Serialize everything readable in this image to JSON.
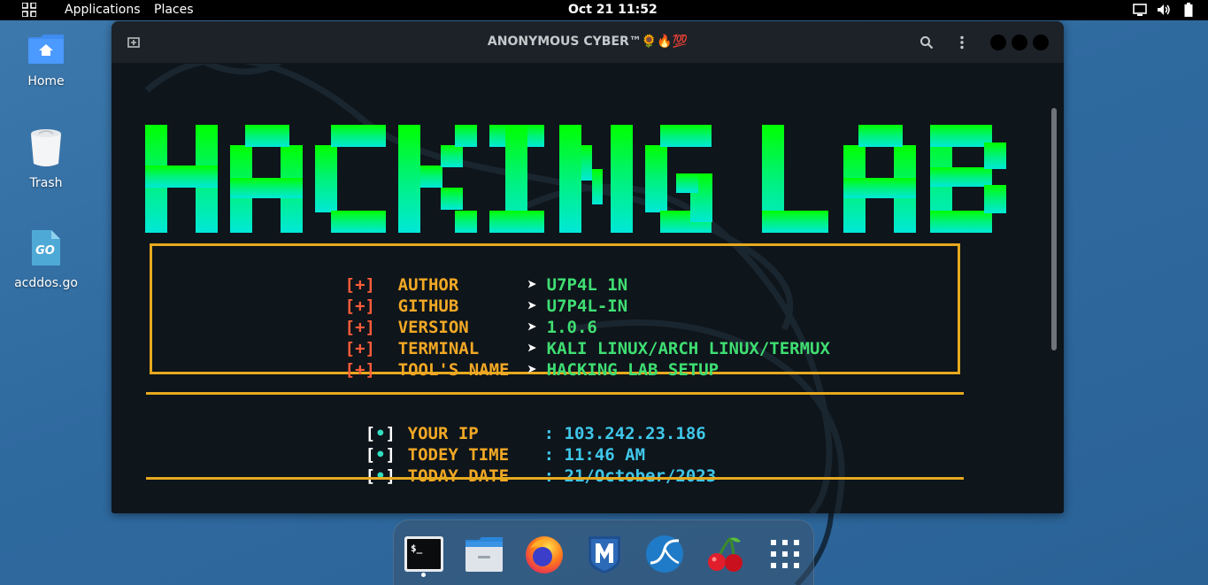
{
  "topbar": {
    "applications_label": "Applications",
    "places_label": "Places",
    "clock": "Oct 21  11:52",
    "icons": [
      "activities-grid-icon",
      "screen-icon",
      "volume-icon",
      "battery-icon"
    ]
  },
  "desktop": {
    "icons": [
      {
        "label": "Home",
        "icon": "home-folder-icon"
      },
      {
        "label": "Trash",
        "icon": "trash-icon"
      },
      {
        "label": "acddos.go",
        "icon": "go-file-icon"
      }
    ]
  },
  "terminal": {
    "title": "ANONYMOUS CYBER™🌻🔥💯",
    "banner": "HACKING LAB",
    "info_rows": [
      {
        "prefix": "[+]",
        "key": "AUTHOR",
        "arrow": "➤",
        "value": "U7P4L 1N"
      },
      {
        "prefix": "[+]",
        "key": "GITHUB",
        "arrow": "➤",
        "value": "U7P4L-IN"
      },
      {
        "prefix": "[+]",
        "key": "VERSION",
        "arrow": "➤",
        "value": "1.0.6"
      },
      {
        "prefix": "[+]",
        "key": "TERMINAL",
        "arrow": "➤",
        "value": "KALI LINUX/ARCH LINUX/TERMUX"
      },
      {
        "prefix": "[+]",
        "key": "TOOL'S NAME",
        "arrow": "➤",
        "value": "HACKING LAB SETUP"
      }
    ],
    "sys_rows": [
      {
        "bracket_open": "[",
        "dot": "•",
        "bracket_close": "]",
        "key": "YOUR IP",
        "sep": ":",
        "value": "103.242.23.186"
      },
      {
        "bracket_open": "[",
        "dot": "•",
        "bracket_close": "]",
        "key": "TODEY TIME",
        "sep": ":",
        "value": "11:46 AM"
      },
      {
        "bracket_open": "[",
        "dot": "•",
        "bracket_close": "]",
        "key": "TODAY DATE",
        "sep": ":",
        "value": "21/October/2023"
      }
    ]
  },
  "dock": {
    "items": [
      "terminal-icon",
      "files-icon",
      "firefox-icon",
      "metasploit-icon",
      "wireshark-icon",
      "cherrytree-icon",
      "show-apps-icon"
    ]
  },
  "colors": {
    "accent_border": "#e6a91e",
    "prefix_red": "#ff5c3a",
    "key_orange": "#f2a825",
    "value_green": "#3fde72",
    "value_cyan": "#3fc7ea",
    "banner_top": "#00ff00",
    "banner_bottom": "#00e8d8"
  }
}
